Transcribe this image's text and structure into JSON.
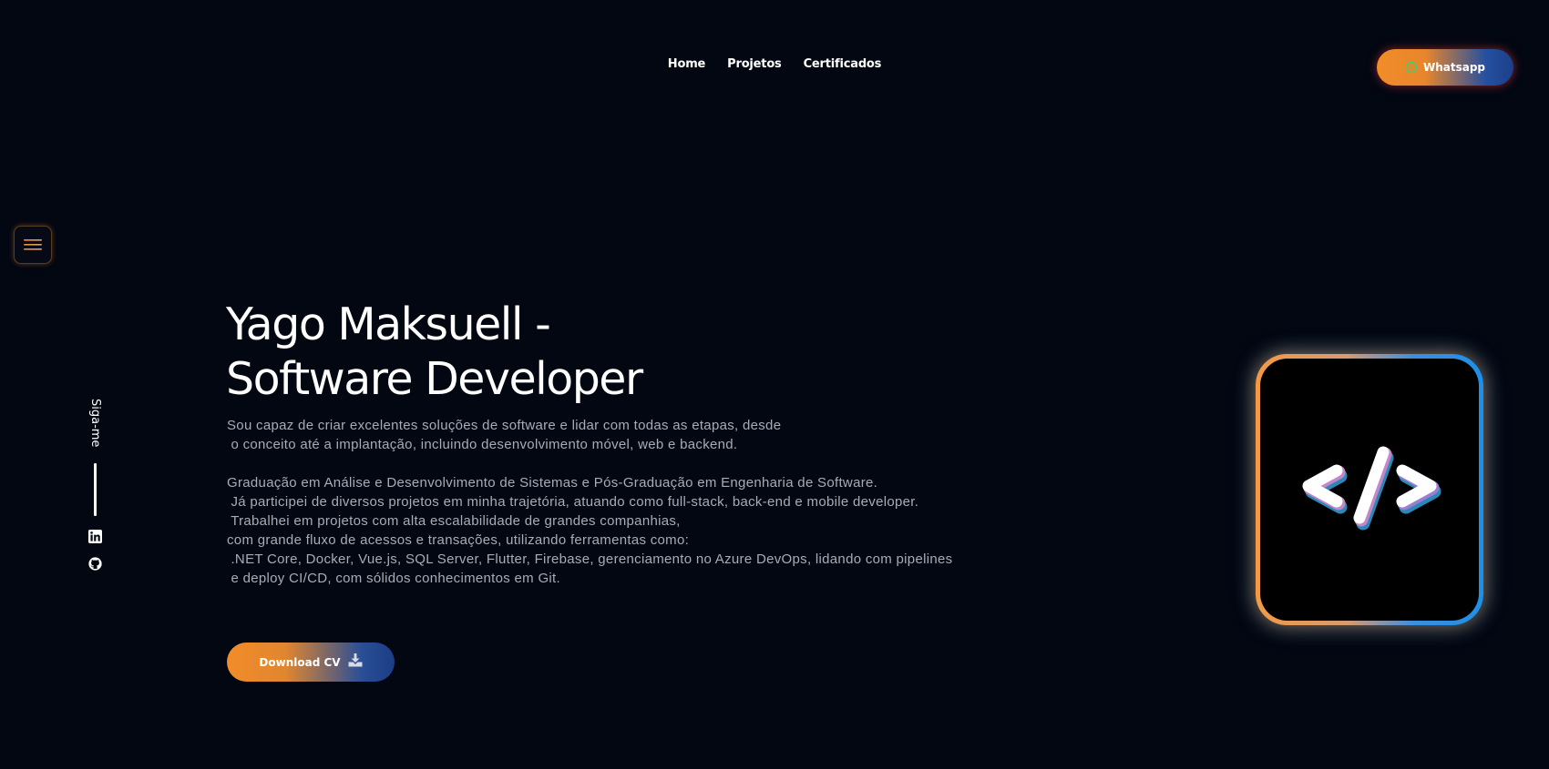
{
  "nav": {
    "items": [
      {
        "label": "Home"
      },
      {
        "label": "Projetos"
      },
      {
        "label": "Certificados"
      }
    ],
    "cta_label": "Whatsapp",
    "cta_icon": "whatsapp-icon"
  },
  "menu": {
    "icon": "hamburger-menu-icon"
  },
  "social": {
    "follow_label": "Siga-me",
    "links": [
      {
        "icon": "linkedin-icon"
      },
      {
        "icon": "github-icon"
      }
    ]
  },
  "hero": {
    "title_line1": "Yago Maksuell -",
    "title_line2": "Software Developer",
    "description": [
      "Sou capaz de criar excelentes soluções de software e lidar com todas as etapas, desde",
      " o conceito até a implantação, incluindo desenvolvimento móvel, web e backend.",
      "",
      "Graduação em Análise e Desenvolvimento de Sistemas e Pós-Graduação em Engenharia de Software.",
      " Já participei de diversos projetos em minha trajetória, atuando como full-stack, back-end e mobile developer.",
      " Trabalhei em projetos com alta escalabilidade de grandes companhias,",
      "com grande fluxo de acessos e transações, utilizando ferramentas como:",
      " .NET Core, Docker, Vue.js, SQL Server, Flutter, Firebase, gerenciamento no Azure DevOps, lidando com pipelines",
      " e deploy CI/CD, com sólidos conhecimentos em Git."
    ],
    "download_label": "Download CV",
    "download_icon": "download-icon",
    "image_icon": "code-brackets-icon"
  },
  "colors": {
    "background": "#030712",
    "accent_orange": "#f28c28",
    "accent_blue": "#1c3f8a",
    "text_muted": "#a6acb8"
  }
}
